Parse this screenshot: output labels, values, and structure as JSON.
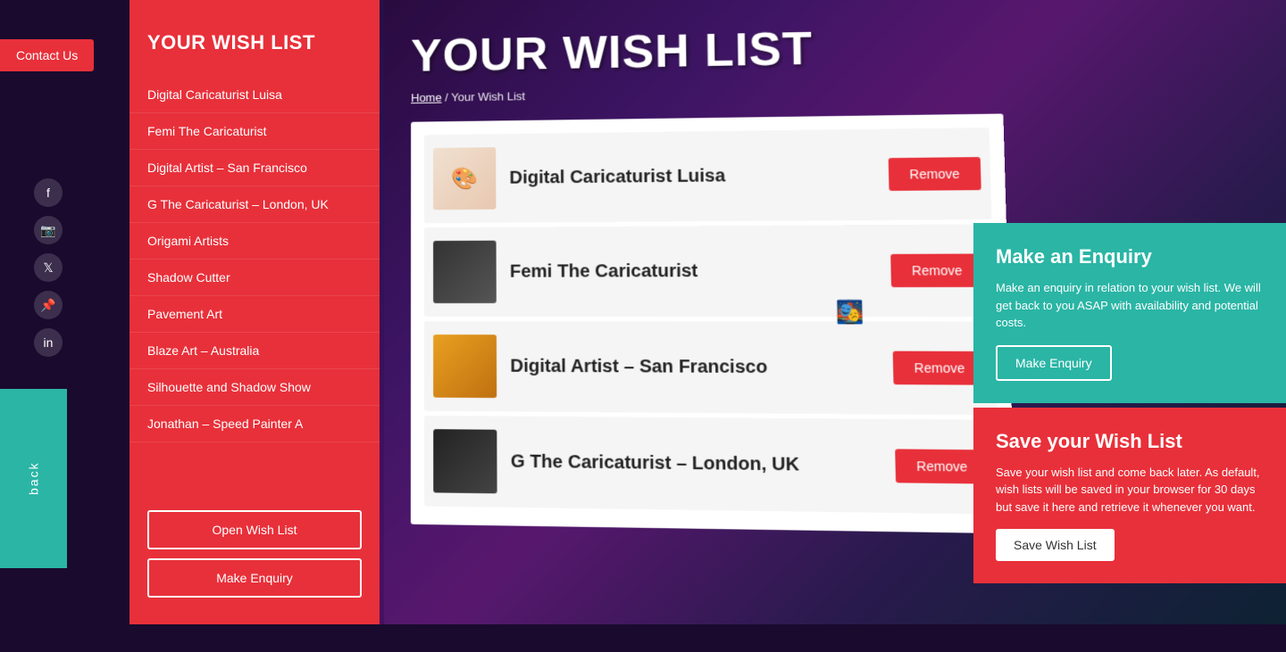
{
  "page": {
    "title": "YOUR WISH LIST",
    "breadcrumb": {
      "home": "Home",
      "current": "Your Wish List"
    }
  },
  "contact_button": "Contact Us",
  "back_button": "back",
  "sidebar": {
    "title": "YOUR WISH LIST",
    "items": [
      {
        "label": "Digital Caricaturist Luisa"
      },
      {
        "label": "Femi The Caricaturist"
      },
      {
        "label": "Digital Artist – San Francisco"
      },
      {
        "label": "G The Caricaturist – London, UK"
      },
      {
        "label": "Origami Artists"
      },
      {
        "label": "Shadow Cutter"
      },
      {
        "label": "Pavement Art"
      },
      {
        "label": "Blaze Art – Australia"
      },
      {
        "label": "Silhouette and Shadow Show"
      },
      {
        "label": "Jonathan – Speed Painter A"
      }
    ],
    "buttons": [
      {
        "label": "Open Wish List"
      },
      {
        "label": "Make Enquiry"
      }
    ]
  },
  "social_icons": [
    {
      "icon": "f",
      "name": "facebook"
    },
    {
      "icon": "📷",
      "name": "instagram"
    },
    {
      "icon": "🐦",
      "name": "twitter"
    },
    {
      "icon": "📌",
      "name": "pinterest"
    },
    {
      "icon": "in",
      "name": "linkedin"
    }
  ],
  "wish_items": [
    {
      "name": "Digital Caricaturist Luisa",
      "remove_label": "Remove",
      "img_class": "img-caricature-luisa"
    },
    {
      "name": "Femi The Caricaturist",
      "remove_label": "Remove",
      "img_class": "img-femi"
    },
    {
      "name": "Digital Artist – San Francisco",
      "remove_label": "Remove",
      "img_class": "img-sf"
    },
    {
      "name": "G The Caricaturist – London, UK",
      "remove_label": "Remove",
      "img_class": "img-g"
    }
  ],
  "enquiry_panel": {
    "title": "Make an Enquiry",
    "description": "Make an enquiry in relation to your wish list. We will get back to you ASAP with availability and potential costs.",
    "button_label": "Make Enquiry"
  },
  "save_panel": {
    "title": "Save your Wish List",
    "description": "Save your wish list and come back later. As default, wish lists will be saved in your browser for 30 days but save it here and retrieve it whenever you want.",
    "button_label": "Save Wish List"
  }
}
